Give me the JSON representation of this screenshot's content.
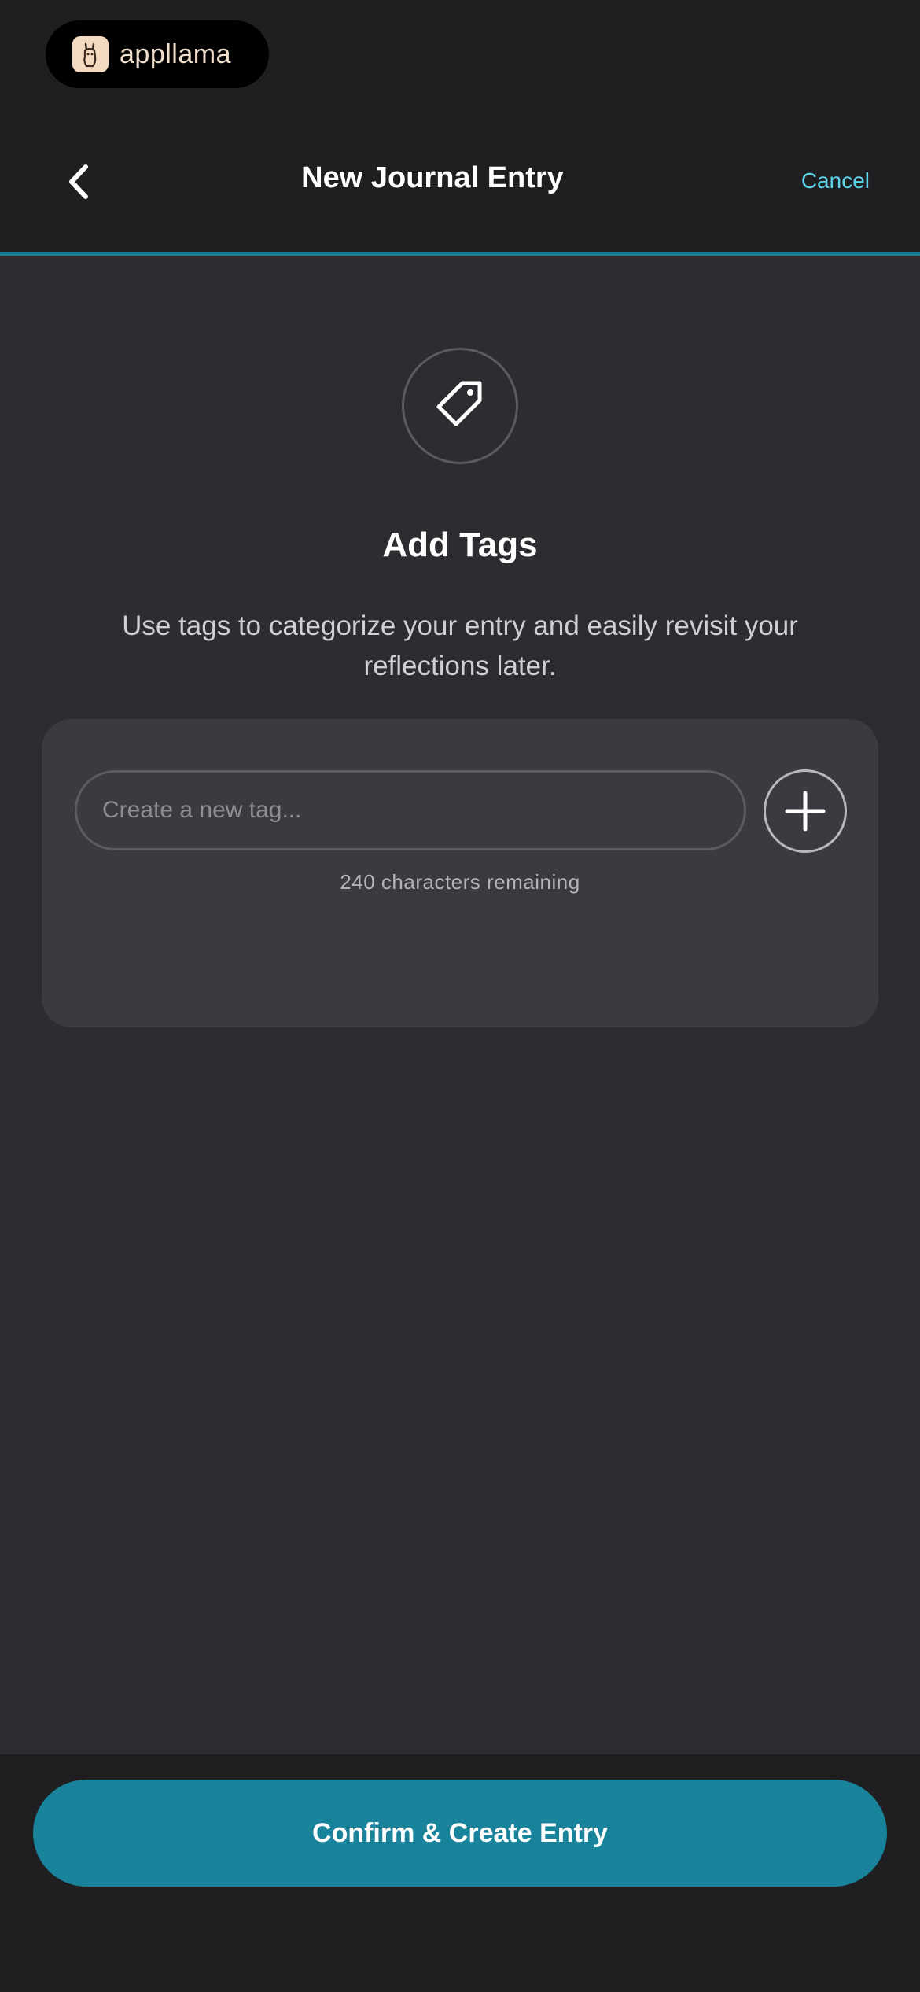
{
  "app": {
    "logo_text": "appllama",
    "logo_icon": "llama-icon"
  },
  "header": {
    "title": "New Journal Entry",
    "back_icon": "chevron-left-icon",
    "cancel_label": "Cancel"
  },
  "content": {
    "icon": "tag-icon",
    "heading": "Add Tags",
    "description": "Use tags to categorize your entry and easily revisit your reflections later.",
    "tag_input": {
      "placeholder": "Create a new tag...",
      "value": ""
    },
    "add_icon": "plus-icon",
    "characters_remaining": "240 characters remaining"
  },
  "footer": {
    "confirm_label": "Confirm & Create Entry"
  },
  "colors": {
    "accent": "#1b7f98",
    "link": "#5fd3ea",
    "background": "#2c2c31",
    "header_bg": "#1f1f22",
    "card_bg": "#3a3a40"
  }
}
